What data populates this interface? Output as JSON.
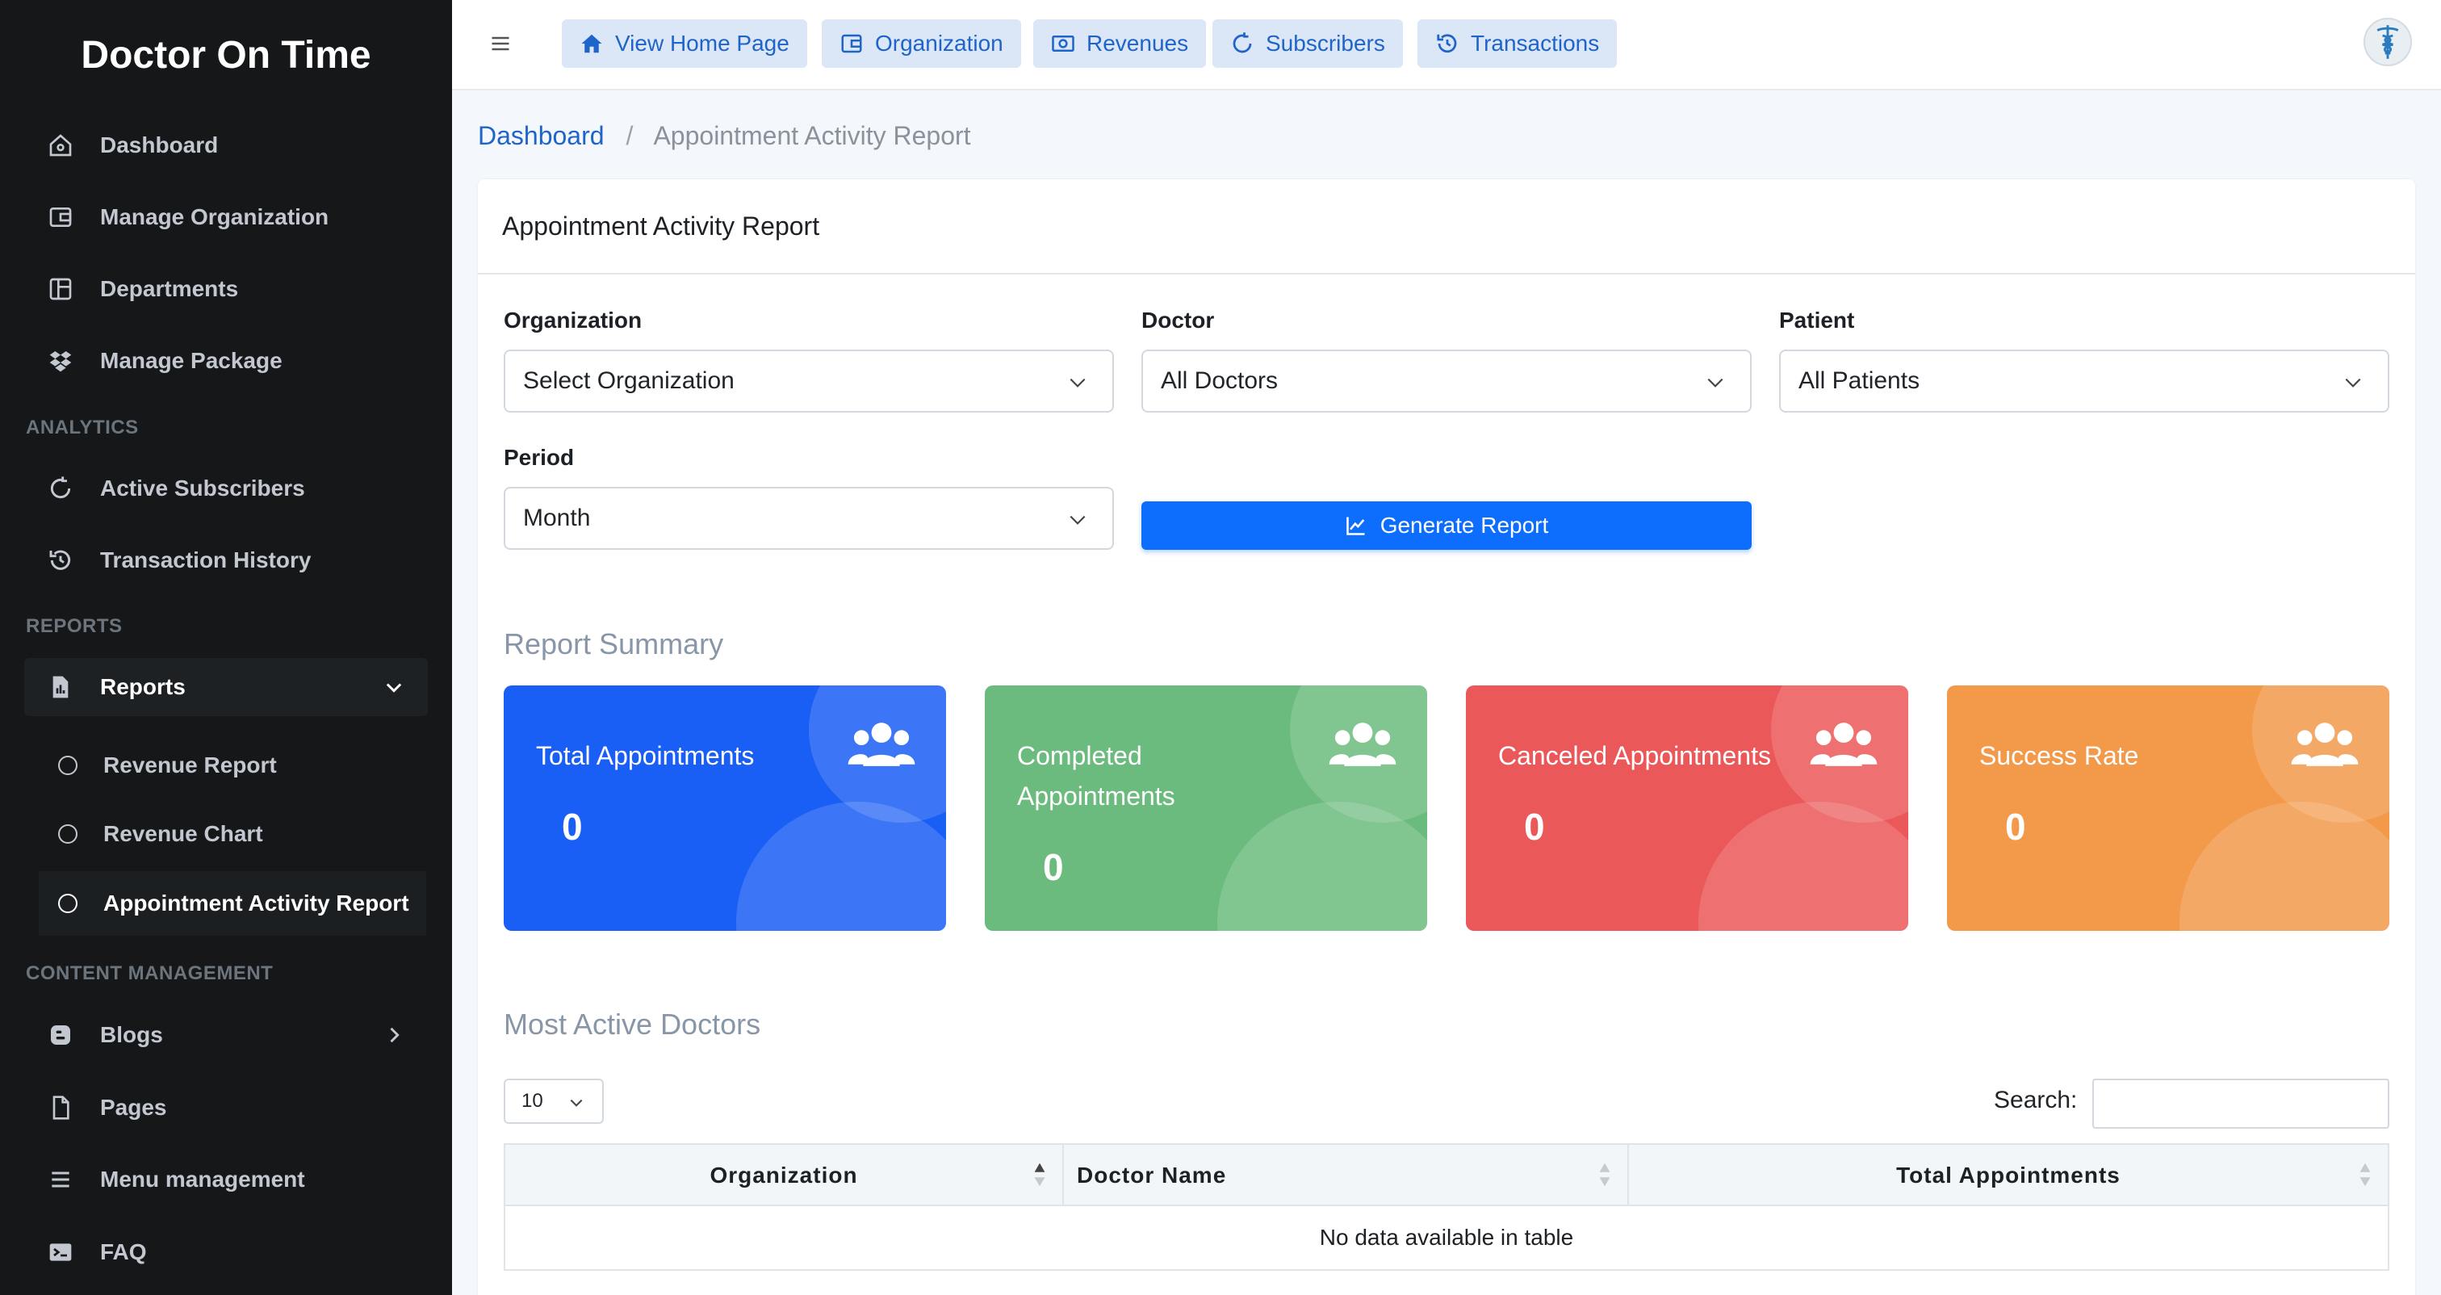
{
  "app": {
    "brand": "Doctor On Time"
  },
  "sidebar": {
    "items": [
      {
        "label": "Dashboard"
      },
      {
        "label": "Manage Organization"
      },
      {
        "label": "Departments"
      },
      {
        "label": "Manage Package"
      }
    ],
    "analytics_label": "ANALYTICS",
    "analytics_items": [
      {
        "label": "Active Subscribers"
      },
      {
        "label": "Transaction History"
      }
    ],
    "reports_label": "REPORTS",
    "reports_group": {
      "label": "Reports"
    },
    "reports_items": [
      {
        "label": "Revenue Report"
      },
      {
        "label": "Revenue Chart"
      },
      {
        "label": "Appointment Activity Report"
      }
    ],
    "content_label": "CONTENT MANAGEMENT",
    "content_items": [
      {
        "label": "Blogs"
      },
      {
        "label": "Pages"
      },
      {
        "label": "Menu management"
      },
      {
        "label": "FAQ"
      }
    ]
  },
  "topbar": {
    "buttons": [
      {
        "label": "View Home Page"
      },
      {
        "label": "Organization"
      },
      {
        "label": "Revenues"
      },
      {
        "label": "Subscribers"
      },
      {
        "label": "Transactions"
      }
    ]
  },
  "breadcrumb": {
    "home": "Dashboard",
    "separator": "/",
    "current": "Appointment Activity Report"
  },
  "card": {
    "title": "Appointment Activity Report"
  },
  "filters": {
    "organization": {
      "label": "Organization",
      "value": "Select Organization"
    },
    "doctor": {
      "label": "Doctor",
      "value": "All Doctors"
    },
    "patient": {
      "label": "Patient",
      "value": "All Patients"
    },
    "period": {
      "label": "Period",
      "value": "Month"
    },
    "generate_label": "Generate Report"
  },
  "summary": {
    "title": "Report Summary",
    "cards": [
      {
        "label": "Total Appointments",
        "value": "0",
        "color": "#1a5ff5"
      },
      {
        "label": "Completed Appointments",
        "value": "0",
        "color": "#6cbb7e"
      },
      {
        "label": "Canceled Appointments",
        "value": "0",
        "color": "#eb5859"
      },
      {
        "label": "Success Rate",
        "value": "0",
        "color": "#f2994a"
      }
    ]
  },
  "doctors": {
    "title": "Most Active Doctors",
    "page_length": "10",
    "search_label": "Search:",
    "columns": [
      "Organization",
      "Doctor Name",
      "Total Appointments"
    ],
    "empty_message": "No data available in table"
  }
}
